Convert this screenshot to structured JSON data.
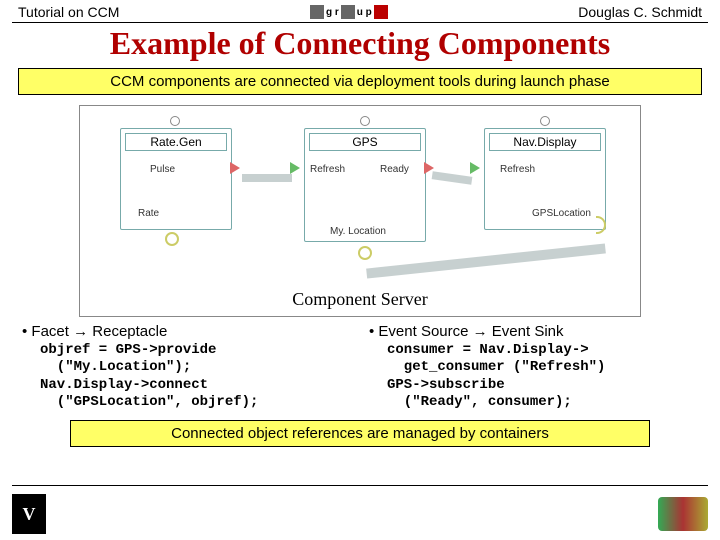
{
  "header": {
    "left": "Tutorial on CCM",
    "right": "Douglas C. Schmidt"
  },
  "title": "Example of Connecting Components",
  "banner_top": "CCM components are connected via deployment tools during launch phase",
  "diagram": {
    "caption": "Component Server",
    "components": {
      "rategen": {
        "name": "Rate.Gen",
        "ports": {
          "pulse": "Pulse",
          "rate": "Rate"
        }
      },
      "gps": {
        "name": "GPS",
        "ports": {
          "refresh": "Refresh",
          "ready": "Ready",
          "myloc": "My. Location"
        }
      },
      "navdisp": {
        "name": "Nav.Display",
        "ports": {
          "refresh": "Refresh",
          "gpsloc": "GPSLocation"
        }
      }
    }
  },
  "left_col": {
    "heading": "• Facet → Receptacle",
    "code": "objref = GPS->provide\n  (\"My.Location\");\nNav.Display->connect\n  (\"GPSLocation\", objref);"
  },
  "right_col": {
    "heading": "• Event Source → Event Sink",
    "code": "consumer = Nav.Display->\n  get_consumer (\"Refresh\")\nGPS->subscribe\n  (\"Ready\", consumer);"
  },
  "banner_bottom": "Connected object references are managed by containers"
}
